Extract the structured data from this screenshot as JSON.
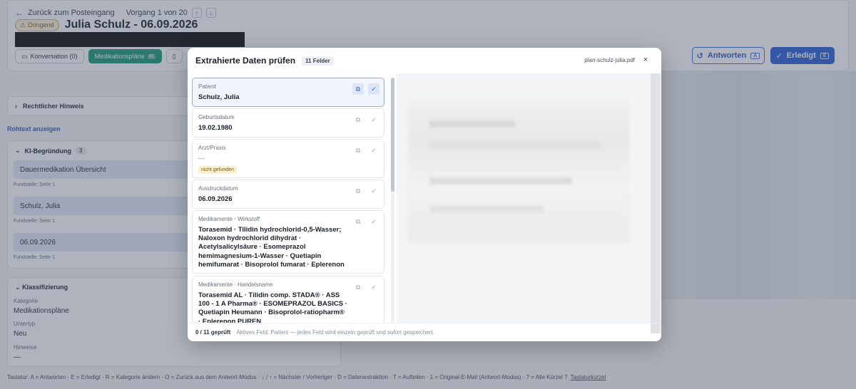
{
  "background": {
    "back_label": "Zurück zum Posteingang",
    "counter": "Vorgang 1 von 20",
    "nav_up": "↑",
    "nav_down": "↓",
    "urgent_badge": "Dringend",
    "case_title": "Julia Schulz - 06.09.2026",
    "tabs": [
      {
        "label": "Konversation (0)"
      },
      {
        "label": "Medikationspläne",
        "kbd": "R"
      }
    ],
    "reply_label": "Antworten",
    "reply_kbd": "A",
    "done_label": "Erledigt",
    "done_kbd": "E",
    "legal_label": "Rechtlicher Hinweis",
    "raw_link": "Rohtext anzeigen",
    "ai": {
      "title": "KI-Begründung",
      "count": "3",
      "items": [
        {
          "text": "Dauermedikation Übersicht",
          "source": "Fundstelle: Seite 1"
        },
        {
          "text": "Schulz, Julia",
          "source": "Fundstelle: Seite 1"
        },
        {
          "text": "06.09.2026",
          "source": "Fundstelle: Seite 1"
        }
      ]
    },
    "classification": {
      "title": "Klassifizierung",
      "category_label": "Kategorie",
      "category_value": "Medikationspläne",
      "subtype_label": "Untertyp",
      "subtype_value": "Neu",
      "hints_label": "Hinweise",
      "hints_value": "—"
    },
    "shortcuts": "Tastatur: A = Antworten · E = Erledigt · R = Kategorie ändern · O = Zurück aus dem Antwort-Modus · ↓ / ↑ = Nächster / Vorheriger · D = Datenextraktion · T = Aufteilen · 1 = Original-E-Mail (Antwort-Modus) · ? = Alle Kürzel  ?",
    "shortcuts_link": "Tastaturkürzel"
  },
  "modal": {
    "title": "Extrahierte Daten prüfen",
    "field_count": "11 Felder",
    "file_name": "plan-schulz-julia.pdf",
    "close": "×",
    "progress": "0 / 11 geprüft",
    "footer_note": "Aktives Feld: Patient — jedes Feld wird einzeln geprüft und sofort gespeichert.",
    "fields": [
      {
        "label": "Patient",
        "value": "Schulz, Julia"
      },
      {
        "label": "Geburtsdatum",
        "value": "19.02.1980"
      },
      {
        "label": "Arzt/Praxis",
        "empty": "—",
        "badge": "nicht gefunden"
      },
      {
        "label": "Ausdruckdatum",
        "value": "06.09.2026"
      },
      {
        "label": "Medikamente · Wirkstoff",
        "value": "Torasemid · Tilidin hydrochlorid-0,5-Wasser; Naloxon hydrochlorid dihydrat · Acetylsalicylsäure · Esomeprazol hemimagnesium-1-Wasser · Quetiapin hemifumarat · Bisoprolol fumarat · Eplerenon"
      },
      {
        "label": "Medikamente · Handelsname",
        "value": "Torasemid AL · Tilidin comp. STADA® · ASS 100 - 1 A Pharma® · ESOMEPRAZOL BASICS · Quetiapin Heumann · Bisoprolol-ratiopharm® · Eplerenon PUREN"
      }
    ]
  }
}
